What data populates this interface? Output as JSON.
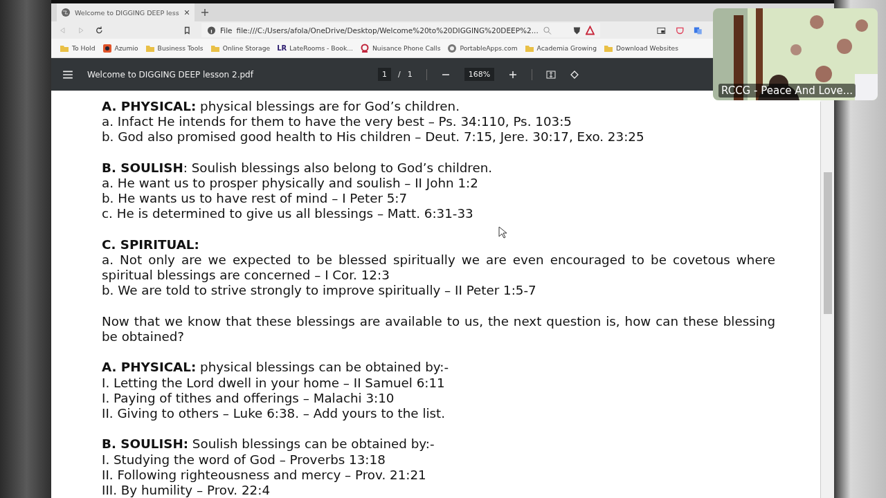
{
  "browser": {
    "tab": {
      "title": "Welcome to DIGGING DEEP less",
      "selected": true
    },
    "address": {
      "scheme": "File",
      "url": "file:///C:/Users/afola/OneDrive/Desktop/Welcome%20to%20DIGGING%20DEEP%2..."
    },
    "bookmarks": [
      {
        "label": "To Hold",
        "kind": "folder"
      },
      {
        "label": "Azumio",
        "kind": "app"
      },
      {
        "label": "Business Tools",
        "kind": "folder"
      },
      {
        "label": "Online Storage",
        "kind": "folder"
      },
      {
        "label": "LateRooms - Book...",
        "kind": "logo",
        "logo": "LR"
      },
      {
        "label": "Nuisance Phone Calls",
        "kind": "ring"
      },
      {
        "label": "PortableApps.com",
        "kind": "disc"
      },
      {
        "label": "Academia Growing",
        "kind": "folder"
      },
      {
        "label": "Download Websites",
        "kind": "folder"
      }
    ]
  },
  "pdf_toolbar": {
    "title": "Welcome to DIGGING DEEP lesson 2.pdf",
    "page": "1",
    "separator": "/",
    "pages": "1",
    "zoom": "168%"
  },
  "document": [
    {
      "kind": "section",
      "lines": [
        "**A. PHYSICAL:** physical blessings are for God’s children.",
        "a. Infact He intends for them to have the very best – Ps. 34:110, Ps. 103:5",
        "b. God also promised good health to His children – Deut. 7:15, Jere. 30:17, Exo. 23:25"
      ]
    },
    {
      "kind": "section",
      "lines": [
        "**B. SOULISH**: Soulish blessings also belong to God’s children.",
        "a. He want us to prosper physically and soulish – II John 1:2",
        "b. He wants us to have rest of mind – I Peter 5:7",
        "c. He is determined to give us all blessings – Matt. 6:31-33"
      ]
    },
    {
      "kind": "section",
      "lines": [
        "**C. SPIRITUAL:**",
        "a. Not only are we expected to be blessed spiritually we are even encouraged to be covetous where spiritual blessings are concerned – I Cor. 12:3",
        "b. We are told to strive strongly to improve spiritually – II Peter 1:5-7"
      ]
    },
    {
      "kind": "section",
      "lines": [
        "Now that we know that these blessings are available to us, the next question is, how can these blessing be obtained?"
      ]
    },
    {
      "kind": "section",
      "lines": [
        "**A. PHYSICAL:** physical blessings can be obtained by:-",
        "I. Letting the Lord dwell in your home – II Samuel 6:11",
        "I. Paying of tithes and offerings – Malachi 3:10",
        "II. Giving to others – Luke 6:38. – Add yours to the list."
      ]
    },
    {
      "kind": "section",
      "lines": [
        "**B. SOULISH:** Soulish blessings can be obtained by:-",
        "I. Studying the word of God – Proverbs 13:18",
        "II. Following righteousness and mercy – Prov. 21:21",
        "III. By humility – Prov. 22:4"
      ]
    }
  ],
  "video_tile": {
    "kind": "picture",
    "caption": "RCCG - Peace And Love..."
  }
}
